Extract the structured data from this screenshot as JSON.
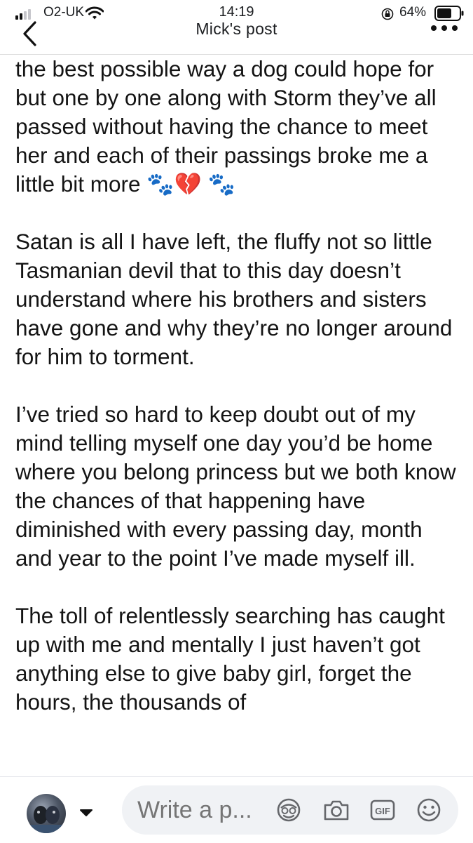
{
  "status_bar": {
    "carrier": "O2-UK",
    "time": "14:19",
    "battery": "64%",
    "icons": [
      "signal-icon",
      "wifi-icon",
      "orientation-lock-icon",
      "battery-icon"
    ]
  },
  "header": {
    "title": "Mick's post",
    "back_icon": "chevron-left-icon",
    "more_icon": "more-dots-icon"
  },
  "post": {
    "paragraphs": [
      "the best possible way a dog could hope for but one by one along with Storm they’ve all passed without having the chance to meet her and each of their passings broke me a little bit more 🐾💔 🐾",
      "Satan is all I have left, the fluffy not so little Tasmanian devil that to this day doesn’t understand where his brothers and sisters have gone and why they’re no longer around for him to torment.",
      "I’ve tried so hard to keep doubt out of my mind telling myself one day you’d be home where you belong princess but we both know the chances of that happening have diminished with every passing day, month and year to the point I’ve made myself ill.",
      "The toll of relentlessly searching has caught up with me and mentally I just haven’t got anything else to give baby girl, forget the hours, the thousands of"
    ]
  },
  "comment_bar": {
    "placeholder": "Write a p...",
    "icons": [
      "avatar-switcher-caret-icon",
      "avatar-sticker-icon",
      "camera-icon",
      "gif-icon",
      "emoji-icon"
    ]
  },
  "colors": {
    "text": "#141414",
    "pill_background": "#f0f2f5",
    "icon_gray": "#65676b",
    "divider": "#dcdcdc"
  }
}
